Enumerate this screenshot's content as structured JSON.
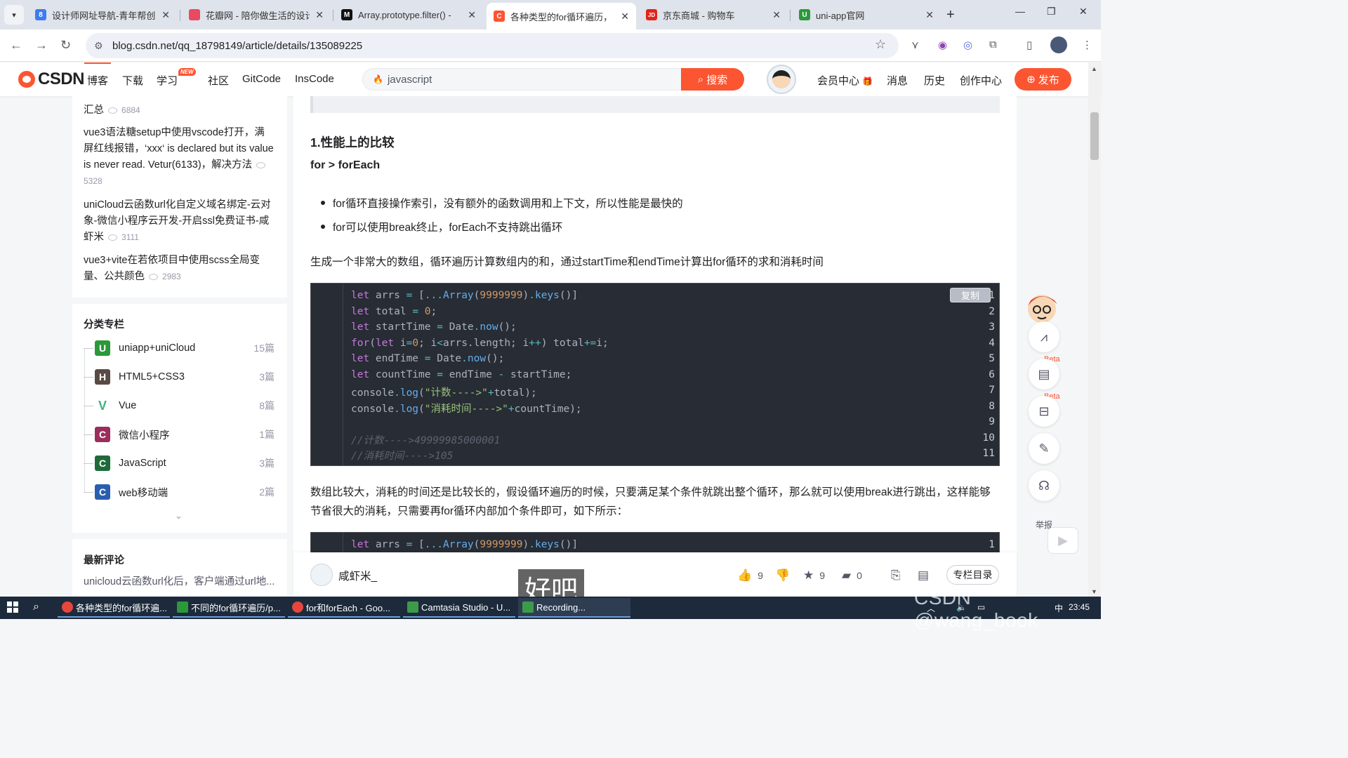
{
  "browser": {
    "tabs": [
      {
        "title": "设计师网址导航-青年帮创业",
        "favicon_color": "#3d7cf0"
      },
      {
        "title": "花瓣网 - 陪你做生活的设计",
        "favicon_color": "#e84a5f"
      },
      {
        "title": "Array.prototype.filter() -",
        "favicon_color": "#111111"
      },
      {
        "title": "各种类型的for循环遍历，",
        "favicon_color": "#fc5531"
      },
      {
        "title": "京东商城 - 购物车",
        "favicon_color": "#e1251b"
      },
      {
        "title": "uni-app官网",
        "favicon_color": "#2b9939"
      }
    ],
    "active_tab_index": 3,
    "url": "blog.csdn.net/qq_18798149/article/details/135089225"
  },
  "csdn_header": {
    "logo": "CSDN",
    "nav": [
      "博客",
      "下载",
      "学习",
      "社区",
      "GitCode",
      "InsCode"
    ],
    "new_badge": "NEW",
    "search_placeholder": "javascript",
    "search_button": "搜索",
    "right_nav": [
      "会员中心",
      "消息",
      "历史",
      "创作中心"
    ],
    "publish_button": "发布",
    "accent": "#fc5531"
  },
  "sidebar": {
    "articles": [
      {
        "title_tail": "汇总",
        "views": "6884"
      },
      {
        "title": "vue3语法糖setup中使用vscode打开，满屏红线报错，‘xxx‘ is declared but its value is never read. Vetur(6133)，解决方法",
        "views": "5328"
      },
      {
        "title": "uniCloud云函数url化自定义域名绑定-云对象-微信小程序云开发-开启ssl免费证书-咸虾米",
        "views": "3111"
      },
      {
        "title": "vue3+vite在若依项目中使用scss全局变量、公共颜色",
        "views": "2983"
      }
    ],
    "category_title": "分类专栏",
    "categories": [
      {
        "name": "uniapp+uniCloud",
        "count": "15篇",
        "icon_color": "#2b9939",
        "glyph": "U"
      },
      {
        "name": "HTML5+CSS3",
        "count": "3篇",
        "icon_color": "#5a4a44",
        "glyph": "H"
      },
      {
        "name": "Vue",
        "count": "8篇",
        "icon_color": "#3fb27f",
        "glyph": "V"
      },
      {
        "name": "微信小程序",
        "count": "1篇",
        "icon_color": "#9b2d5c",
        "glyph": "C"
      },
      {
        "name": "JavaScript",
        "count": "3篇",
        "icon_color": "#1e6b3a",
        "glyph": "C"
      },
      {
        "name": "web移动端",
        "count": "2篇",
        "icon_color": "#2a5fb0",
        "glyph": "C"
      }
    ],
    "comments_title": "最新评论",
    "comment_preview": "unicloud云函数url化后，客户端通过url地..."
  },
  "article": {
    "heading": "1.性能上的比较",
    "subheading": "for > forEach",
    "bullets": [
      "for循环直接操作索引，没有额外的函数调用和上下文，所以性能是最快的",
      "for可以使用break终止，forEach不支持跳出循环"
    ],
    "para1": "生成一个非常大的数组，循环遍历计算数组内的和，通过startTime和endTime计算出for循环的求和消耗时间",
    "copy_button": "复制",
    "code_lines": [
      "1",
      "2",
      "3",
      "4",
      "5",
      "6",
      "7",
      "8",
      "9",
      "10",
      "11"
    ],
    "para2": "数组比较大，消耗的时间还是比较长的，假设循环遍历的时候，只要满足某个条件就跳出整个循环，那么就可以使用break进行跳出，这样能够节省很大的消耗，只需要再for循环内部加个条件即可，如下所示：",
    "code2_line": "1"
  },
  "author_bar": {
    "name": "咸虾米_",
    "likes": "9",
    "favorites": "9",
    "comments": "0",
    "column_button": "专栏目录"
  },
  "right_tools": {
    "beta": "Beta",
    "report": "举报"
  },
  "overlay": {
    "subtitle": "好吧",
    "watermark": "CSDN @wang_book"
  },
  "taskbar": {
    "apps": [
      {
        "label": "各种类型的for循环遍...",
        "icon_color": "#e8453c"
      },
      {
        "label": "不同的for循环遍历/p...",
        "icon_color": "#2b9939"
      },
      {
        "label": "for和forEach - Goo...",
        "icon_color": "#e8453c"
      },
      {
        "label": "Camtasia Studio - U...",
        "icon_color": "#3c9a4b"
      },
      {
        "label": "Recording...",
        "icon_color": "#3c9a4b"
      }
    ],
    "time": "23:45"
  }
}
